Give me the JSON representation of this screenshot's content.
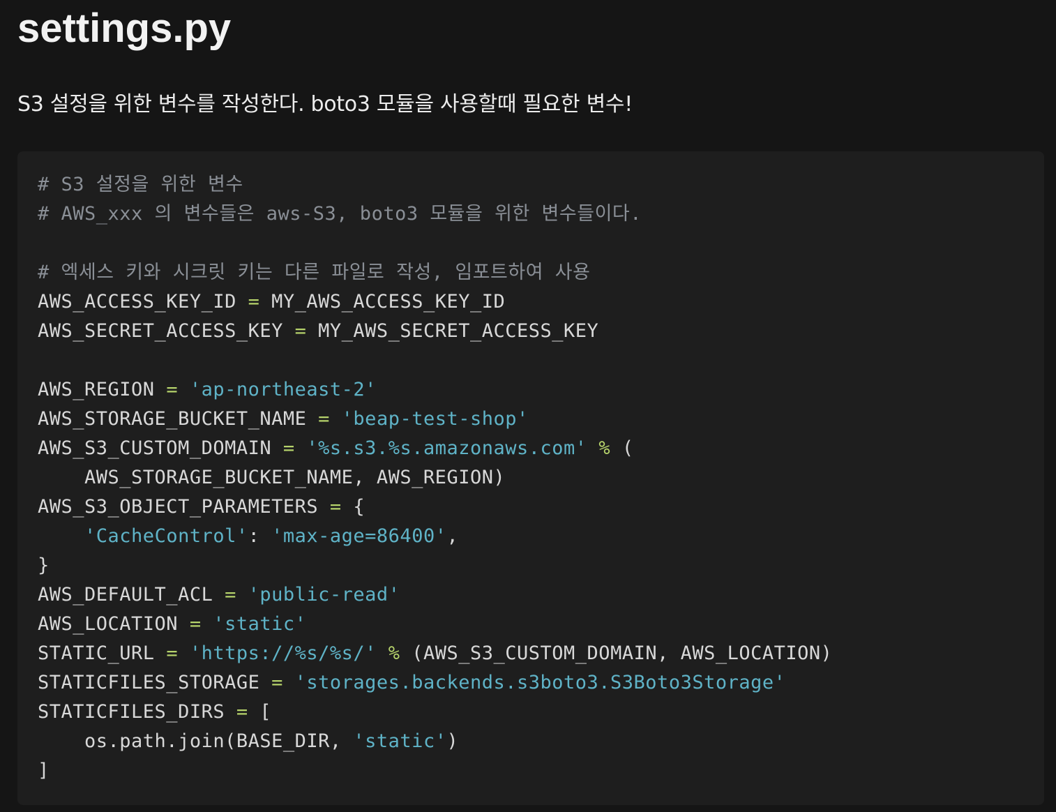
{
  "document": {
    "heading": "settings.py",
    "intro": "S3 설정을 위한 변수를 작성한다. boto3 모듈을 사용할때 필요한 변수!"
  },
  "colors": {
    "background": "#151515",
    "code_background": "#1e1e1e",
    "comment": "#8a8f96",
    "string": "#5fb3c7",
    "operator": "#b6d36b",
    "text": "#d8d8d8"
  },
  "code": {
    "language": "python",
    "lines": [
      [
        {
          "t": "comment",
          "v": "# S3 설정을 위한 변수"
        }
      ],
      [
        {
          "t": "comment",
          "v": "# AWS_xxx 의 변수들은 aws-S3, boto3 모듈을 위한 변수들이다."
        }
      ],
      [],
      [
        {
          "t": "comment",
          "v": "# 엑세스 키와 시크릿 키는 다른 파일로 작성, 임포트하여 사용"
        }
      ],
      [
        {
          "t": "plain",
          "v": "AWS_ACCESS_KEY_ID "
        },
        {
          "t": "op",
          "v": "="
        },
        {
          "t": "plain",
          "v": " MY_AWS_ACCESS_KEY_ID"
        }
      ],
      [
        {
          "t": "plain",
          "v": "AWS_SECRET_ACCESS_KEY "
        },
        {
          "t": "op",
          "v": "="
        },
        {
          "t": "plain",
          "v": " MY_AWS_SECRET_ACCESS_KEY"
        }
      ],
      [],
      [
        {
          "t": "plain",
          "v": "AWS_REGION "
        },
        {
          "t": "op",
          "v": "="
        },
        {
          "t": "plain",
          "v": " "
        },
        {
          "t": "string",
          "v": "'ap-northeast-2'"
        }
      ],
      [
        {
          "t": "plain",
          "v": "AWS_STORAGE_BUCKET_NAME "
        },
        {
          "t": "op",
          "v": "="
        },
        {
          "t": "plain",
          "v": " "
        },
        {
          "t": "string",
          "v": "'beap-test-shop'"
        }
      ],
      [
        {
          "t": "plain",
          "v": "AWS_S3_CUSTOM_DOMAIN "
        },
        {
          "t": "op",
          "v": "="
        },
        {
          "t": "plain",
          "v": " "
        },
        {
          "t": "string",
          "v": "'%s.s3.%s.amazonaws.com'"
        },
        {
          "t": "plain",
          "v": " "
        },
        {
          "t": "op",
          "v": "%"
        },
        {
          "t": "plain",
          "v": " ("
        }
      ],
      [
        {
          "t": "plain",
          "v": "    AWS_STORAGE_BUCKET_NAME, AWS_REGION)"
        }
      ],
      [
        {
          "t": "plain",
          "v": "AWS_S3_OBJECT_PARAMETERS "
        },
        {
          "t": "op",
          "v": "="
        },
        {
          "t": "plain",
          "v": " {"
        }
      ],
      [
        {
          "t": "plain",
          "v": "    "
        },
        {
          "t": "string",
          "v": "'CacheControl'"
        },
        {
          "t": "plain",
          "v": ": "
        },
        {
          "t": "string",
          "v": "'max-age=86400'"
        },
        {
          "t": "plain",
          "v": ","
        }
      ],
      [
        {
          "t": "plain",
          "v": "}"
        }
      ],
      [
        {
          "t": "plain",
          "v": "AWS_DEFAULT_ACL "
        },
        {
          "t": "op",
          "v": "="
        },
        {
          "t": "plain",
          "v": " "
        },
        {
          "t": "string",
          "v": "'public-read'"
        }
      ],
      [
        {
          "t": "plain",
          "v": "AWS_LOCATION "
        },
        {
          "t": "op",
          "v": "="
        },
        {
          "t": "plain",
          "v": " "
        },
        {
          "t": "string",
          "v": "'static'"
        }
      ],
      [
        {
          "t": "plain",
          "v": "STATIC_URL "
        },
        {
          "t": "op",
          "v": "="
        },
        {
          "t": "plain",
          "v": " "
        },
        {
          "t": "string",
          "v": "'https://%s/%s/'"
        },
        {
          "t": "plain",
          "v": " "
        },
        {
          "t": "op",
          "v": "%"
        },
        {
          "t": "plain",
          "v": " (AWS_S3_CUSTOM_DOMAIN, AWS_LOCATION)"
        }
      ],
      [
        {
          "t": "plain",
          "v": "STATICFILES_STORAGE "
        },
        {
          "t": "op",
          "v": "="
        },
        {
          "t": "plain",
          "v": " "
        },
        {
          "t": "string",
          "v": "'storages.backends.s3boto3.S3Boto3Storage'"
        }
      ],
      [
        {
          "t": "plain",
          "v": "STATICFILES_DIRS "
        },
        {
          "t": "op",
          "v": "="
        },
        {
          "t": "plain",
          "v": " ["
        }
      ],
      [
        {
          "t": "plain",
          "v": "    os.path.join(BASE_DIR, "
        },
        {
          "t": "string",
          "v": "'static'"
        },
        {
          "t": "plain",
          "v": ")"
        }
      ],
      [
        {
          "t": "plain",
          "v": "]"
        }
      ]
    ]
  }
}
